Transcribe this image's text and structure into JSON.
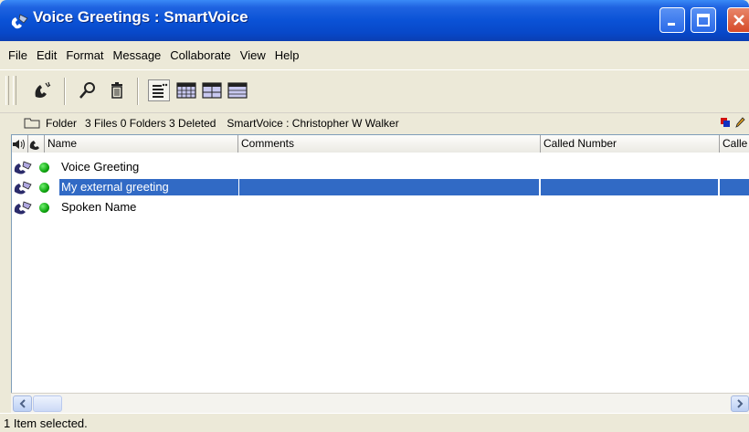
{
  "window": {
    "title": "Voice Greetings : SmartVoice",
    "app_icon": "voice-mail-icon",
    "controls": {
      "minimize": "minimize-icon",
      "maximize": "maximize-icon",
      "close": "close-icon"
    }
  },
  "menu": [
    "File",
    "Edit",
    "Format",
    "Message",
    "Collaborate",
    "View",
    "Help"
  ],
  "toolbar": {
    "tools": [
      {
        "name": "record-call-icon",
        "pressed": false
      },
      {
        "name": "find-icon",
        "pressed": false
      },
      {
        "name": "delete-icon",
        "pressed": false
      },
      {
        "name": "details-view-icon",
        "pressed": true
      },
      {
        "name": "calendar-month-icon",
        "pressed": false
      },
      {
        "name": "calendar-week-icon",
        "pressed": false
      },
      {
        "name": "calendar-day-icon",
        "pressed": false
      }
    ]
  },
  "folder": {
    "label": "Folder",
    "summary": "3 Files 0 Folders 3 Deleted",
    "location": "SmartVoice : Christopher W Walker"
  },
  "list": {
    "columns": [
      "Name",
      "Comments",
      "Called Number",
      "Calle"
    ],
    "rows": [
      {
        "name": "Voice Greeting",
        "selected": false
      },
      {
        "name": "My external greeting",
        "selected": true
      },
      {
        "name": "Spoken Name",
        "selected": false
      }
    ]
  },
  "status": {
    "text": "1 Item selected."
  },
  "colors": {
    "titlebar": "#0a52d6",
    "selection": "#316ac5",
    "chrome": "#ece9d8"
  }
}
